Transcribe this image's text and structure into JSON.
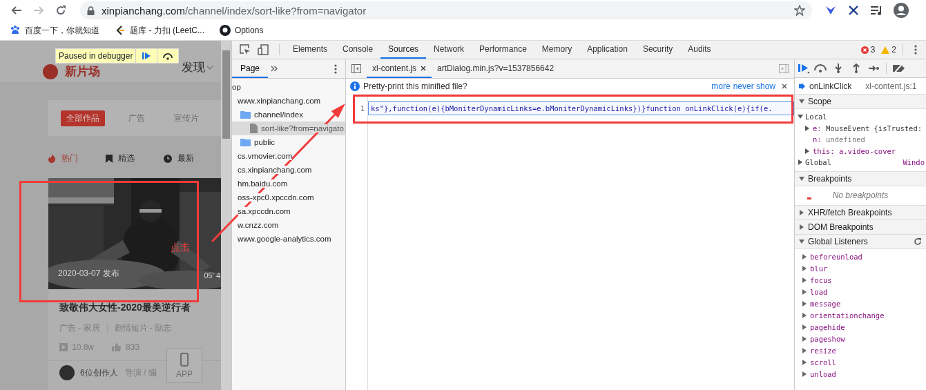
{
  "browser": {
    "url_host": "xinpianchang.com",
    "url_path": "/channel/index/sort-like?from=navigator",
    "bookmarks": [
      {
        "kind": "paw",
        "label": "百度一下，你就知道"
      },
      {
        "kind": "leetcode",
        "label": "题库 - 力扣 (LeetC..."
      },
      {
        "kind": "github",
        "label": "Options"
      }
    ]
  },
  "page": {
    "logo": "新片场",
    "nav_item": "发现",
    "filters": [
      {
        "label": "全部作品",
        "selected": true
      },
      {
        "label": "广告",
        "selected": false
      },
      {
        "label": "宣传片",
        "selected": false
      }
    ],
    "sort_tabs": [
      {
        "kind": "hot",
        "label": "热门",
        "selected": true
      },
      {
        "kind": "picked",
        "label": "精选",
        "selected": false
      },
      {
        "kind": "latest",
        "label": "最新",
        "selected": false
      }
    ],
    "video": {
      "kind": "picture",
      "date": "2020-03-07 发布",
      "duration": "05' 4",
      "title": "致敬伟大女性-2020最美逆行者",
      "category": "广告 - 家居",
      "genre": "剧情短片 - 励志",
      "plays": "10.8w",
      "likes": "833",
      "creators": "6位创作人",
      "roles": "导演 / 编"
    },
    "app_button": "APP"
  },
  "debugger_banner": {
    "label": "Paused in debugger"
  },
  "devtools": {
    "tabs": [
      {
        "label": "Elements",
        "selected": false
      },
      {
        "label": "Console",
        "selected": false
      },
      {
        "label": "Sources",
        "selected": true
      },
      {
        "label": "Network",
        "selected": false
      },
      {
        "label": "Performance",
        "selected": false
      },
      {
        "label": "Memory",
        "selected": false
      },
      {
        "label": "Application",
        "selected": false
      },
      {
        "label": "Security",
        "selected": false
      },
      {
        "label": "Audits",
        "selected": false
      }
    ],
    "errors": "3",
    "warnings": "2",
    "navigator": {
      "tabs": [
        {
          "label": "Page",
          "selected": true
        }
      ],
      "tree": [
        {
          "kind": "frame",
          "label": "op",
          "selected": false,
          "children": [
            {
              "kind": "domain",
              "label": "www.xinpianchang.com",
              "selected": false,
              "children": [
                {
                  "kind": "folder",
                  "label": "channel/index",
                  "selected": false,
                  "children": [
                    {
                      "kind": "file",
                      "label": "sort-like?from=navigato",
                      "selected": true
                    }
                  ]
                },
                {
                  "kind": "folder",
                  "label": "public",
                  "selected": false
                }
              ]
            },
            {
              "kind": "domain",
              "label": "cs.vmovier.com",
              "selected": false
            },
            {
              "kind": "domain",
              "label": "cs.xinpianchang.com",
              "selected": false
            },
            {
              "kind": "domain",
              "label": "hm.baidu.com",
              "selected": false
            },
            {
              "kind": "domain",
              "label": "oss-xpc0.xpccdn.com",
              "selected": false
            },
            {
              "kind": "domain",
              "label": "sa.xpccdn.com",
              "selected": false
            },
            {
              "kind": "domain",
              "label": "w.cnzz.com",
              "selected": false
            },
            {
              "kind": "domain",
              "label": "www.google-analytics.com",
              "selected": false
            }
          ]
        }
      ]
    },
    "editor": {
      "tabs": [
        {
          "label": "xl-content.js",
          "selected": true,
          "closable": true
        },
        {
          "label": "artDialog.min.js?v=1537856642",
          "selected": false,
          "closable": false
        }
      ],
      "infobar": {
        "text": "Pretty-print this minified file?",
        "links": [
          "more",
          "never show"
        ]
      },
      "lines": [
        {
          "number": "1",
          "code": "ks\"},function(e){bMoniterDynamicLinks=e.bMoniterDynamicLinks})}function onLinkClick(e){if(e.",
          "current": true
        }
      ]
    },
    "sidebar": {
      "call_frame": {
        "name": "onLinkClick",
        "location": "xl-content.js:1"
      },
      "sections": [
        {
          "kind": "scope",
          "title": "Scope",
          "expanded": true,
          "scopes": [
            {
              "name": "Local",
              "expanded": true,
              "vars": [
                {
                  "name": "e:",
                  "value": "MouseEvent {isTrusted:",
                  "expandable": true,
                  "kind": "object"
                },
                {
                  "name": "n:",
                  "value": "undefined",
                  "expandable": false,
                  "kind": "undefined"
                },
                {
                  "name": "this:",
                  "value": "a.video-cover",
                  "expandable": true,
                  "kind": "node"
                }
              ]
            },
            {
              "name": "Global",
              "expanded": false,
              "value": "Windo"
            }
          ]
        },
        {
          "kind": "breakpoints",
          "title": "Breakpoints",
          "expanded": true,
          "empty_text": "No breakpoints"
        },
        {
          "kind": "plain",
          "title": "XHR/fetch Breakpoints",
          "expanded": false
        },
        {
          "kind": "plain",
          "title": "DOM Breakpoints",
          "expanded": false
        },
        {
          "kind": "listeners",
          "title": "Global Listeners",
          "expanded": true,
          "items": [
            "beforeunload",
            "blur",
            "focus",
            "load",
            "message",
            "orientationchange",
            "pagehide",
            "pageshow",
            "resize",
            "scroll",
            "unload"
          ]
        }
      ]
    }
  },
  "annotation": {
    "label": "点击"
  }
}
